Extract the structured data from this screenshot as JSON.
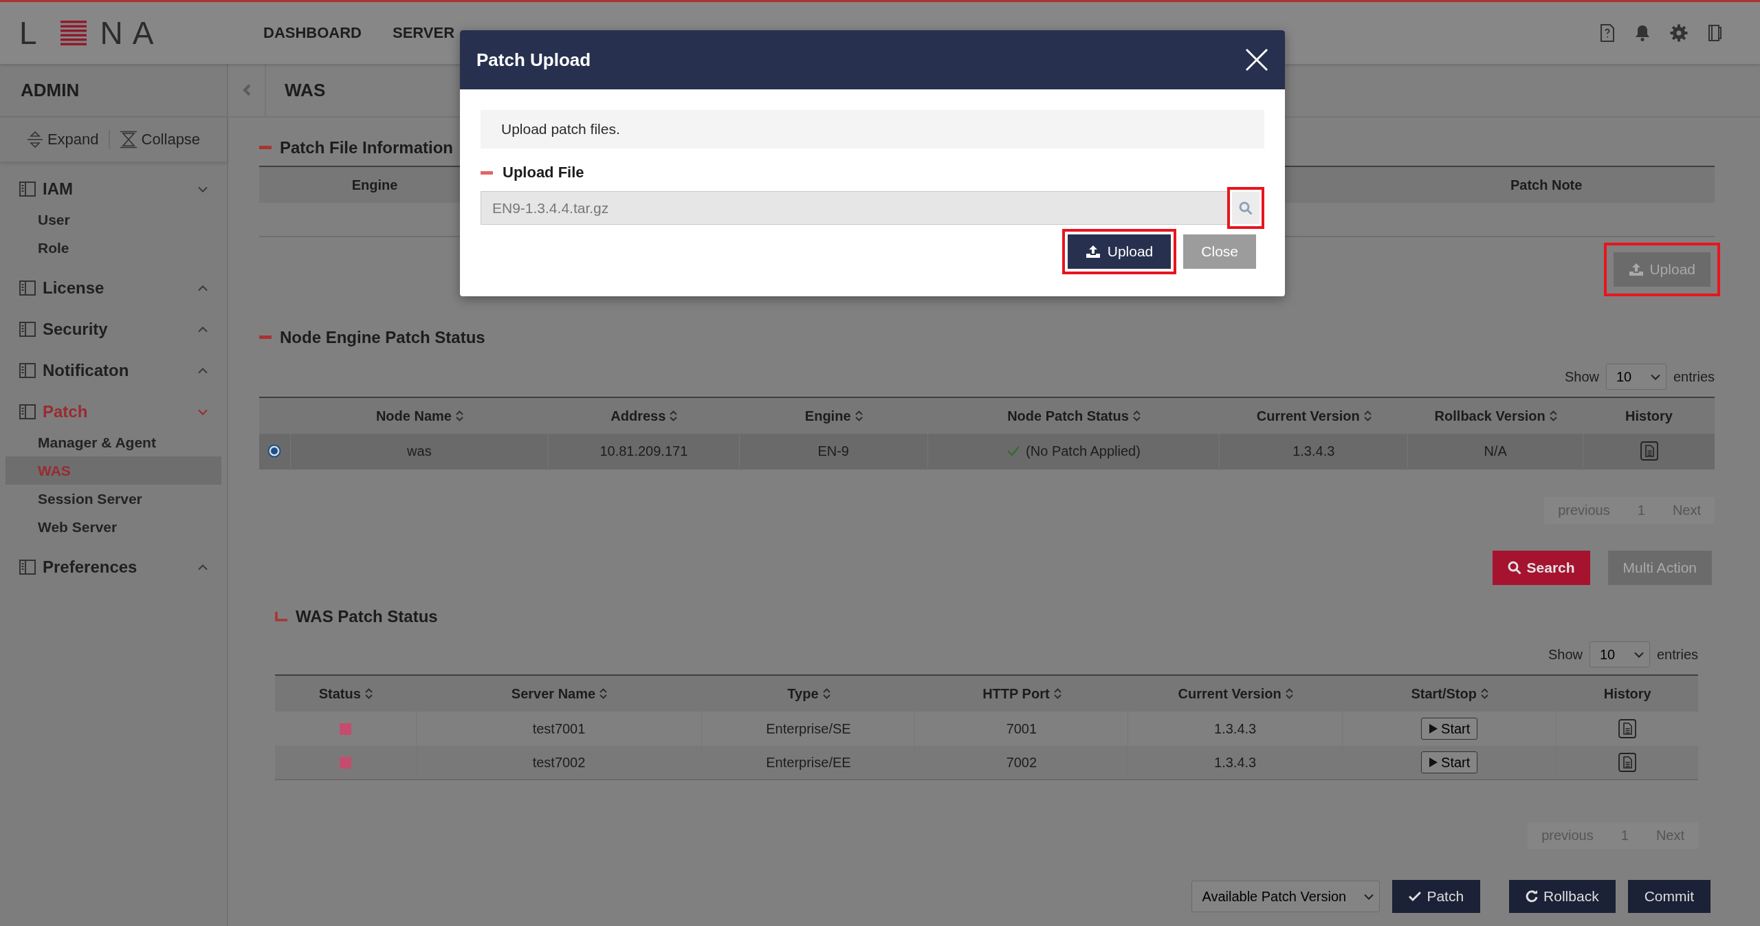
{
  "header": {
    "logo_start": "L",
    "logo_end": "NA",
    "nav": [
      {
        "label": "DASHBOARD",
        "selected": false
      },
      {
        "label": "SERVER",
        "selected": false
      }
    ]
  },
  "sidebar": {
    "title": "ADMIN",
    "expand": "Expand",
    "collapse": "Collapse",
    "groups": [
      {
        "label": "IAM",
        "expanded": true,
        "selected": false,
        "children": [
          {
            "label": "User",
            "selected": false
          },
          {
            "label": "Role",
            "selected": false
          }
        ]
      },
      {
        "label": "License",
        "expanded": false,
        "selected": false
      },
      {
        "label": "Security",
        "expanded": false,
        "selected": false
      },
      {
        "label": "Notificaton",
        "expanded": false,
        "selected": false
      },
      {
        "label": "Patch",
        "expanded": true,
        "selected": true,
        "children": [
          {
            "label": "Manager & Agent",
            "selected": false
          },
          {
            "label": "WAS",
            "selected": true
          },
          {
            "label": "Session Server",
            "selected": false
          },
          {
            "label": "Web Server",
            "selected": false
          }
        ]
      },
      {
        "label": "Preferences",
        "expanded": false,
        "selected": false
      }
    ]
  },
  "breadcrumb": {
    "title": "WAS"
  },
  "patch_file_info": {
    "title": "Patch File Information",
    "columns": [
      "Engine",
      "Patch Note"
    ],
    "upload_button": {
      "label": "Upload",
      "disabled": true,
      "highlighted": true
    }
  },
  "node_engine_patch_status": {
    "title": "Node Engine Patch Status",
    "show": "Show",
    "page_size": "10",
    "entries": "entries",
    "columns": [
      {
        "label": "Node Name",
        "sortable": true
      },
      {
        "label": "Address",
        "sortable": true
      },
      {
        "label": "Engine",
        "sortable": true
      },
      {
        "label": "Node Patch Status",
        "sortable": true
      },
      {
        "label": "Current Version",
        "sortable": true
      },
      {
        "label": "Rollback Version",
        "sortable": true
      },
      {
        "label": "History",
        "sortable": false
      }
    ],
    "rows": [
      {
        "selected": true,
        "node_name": "was",
        "address": "10.81.209.171",
        "engine": "EN-9",
        "patch_status": "(No Patch Applied)",
        "current_version": "1.3.4.3",
        "rollback_version": "N/A"
      }
    ],
    "pagination": {
      "previous": "previous",
      "page": "1",
      "next": "Next"
    },
    "actions": [
      {
        "label": "Search",
        "kind": "primary"
      },
      {
        "label": "Multi Action",
        "kind": "disabled"
      }
    ]
  },
  "was_patch_status": {
    "title": "WAS Patch Status",
    "show": "Show",
    "page_size": "10",
    "entries": "entries",
    "columns": [
      {
        "label": "Status",
        "sortable": true
      },
      {
        "label": "Server Name",
        "sortable": true
      },
      {
        "label": "Type",
        "sortable": true
      },
      {
        "label": "HTTP Port",
        "sortable": true
      },
      {
        "label": "Current Version",
        "sortable": true
      },
      {
        "label": "Start/Stop",
        "sortable": true
      },
      {
        "label": "History",
        "sortable": false
      }
    ],
    "rows": [
      {
        "color": "#c44d6f",
        "server_name": "test7001",
        "type": "Enterprise/SE",
        "http_port": "7001",
        "current_version": "1.3.4.3",
        "start_stop": "Start"
      },
      {
        "color": "#c44d6f",
        "server_name": "test7002",
        "type": "Enterprise/EE",
        "http_port": "7002",
        "current_version": "1.3.4.3",
        "start_stop": "Start"
      }
    ],
    "pagination": {
      "previous": "previous",
      "page": "1",
      "next": "Next"
    }
  },
  "footer": {
    "patch_version": "Available Patch Version",
    "buttons": [
      {
        "label": "Patch",
        "kind": "check"
      },
      {
        "label": "Rollback",
        "kind": "rollback"
      },
      {
        "label": "Commit",
        "kind": "plain"
      }
    ]
  },
  "modal": {
    "title": "Patch Upload",
    "info": "Upload patch files.",
    "field_label": "Upload File",
    "file": {
      "value": "EN9-1.3.4.4.tar.gz"
    },
    "search_highlighted": true,
    "buttons": [
      {
        "label": "Upload",
        "kind": "primary",
        "highlighted": true
      },
      {
        "label": "Close",
        "kind": "secondary",
        "highlighted": false
      }
    ]
  }
}
